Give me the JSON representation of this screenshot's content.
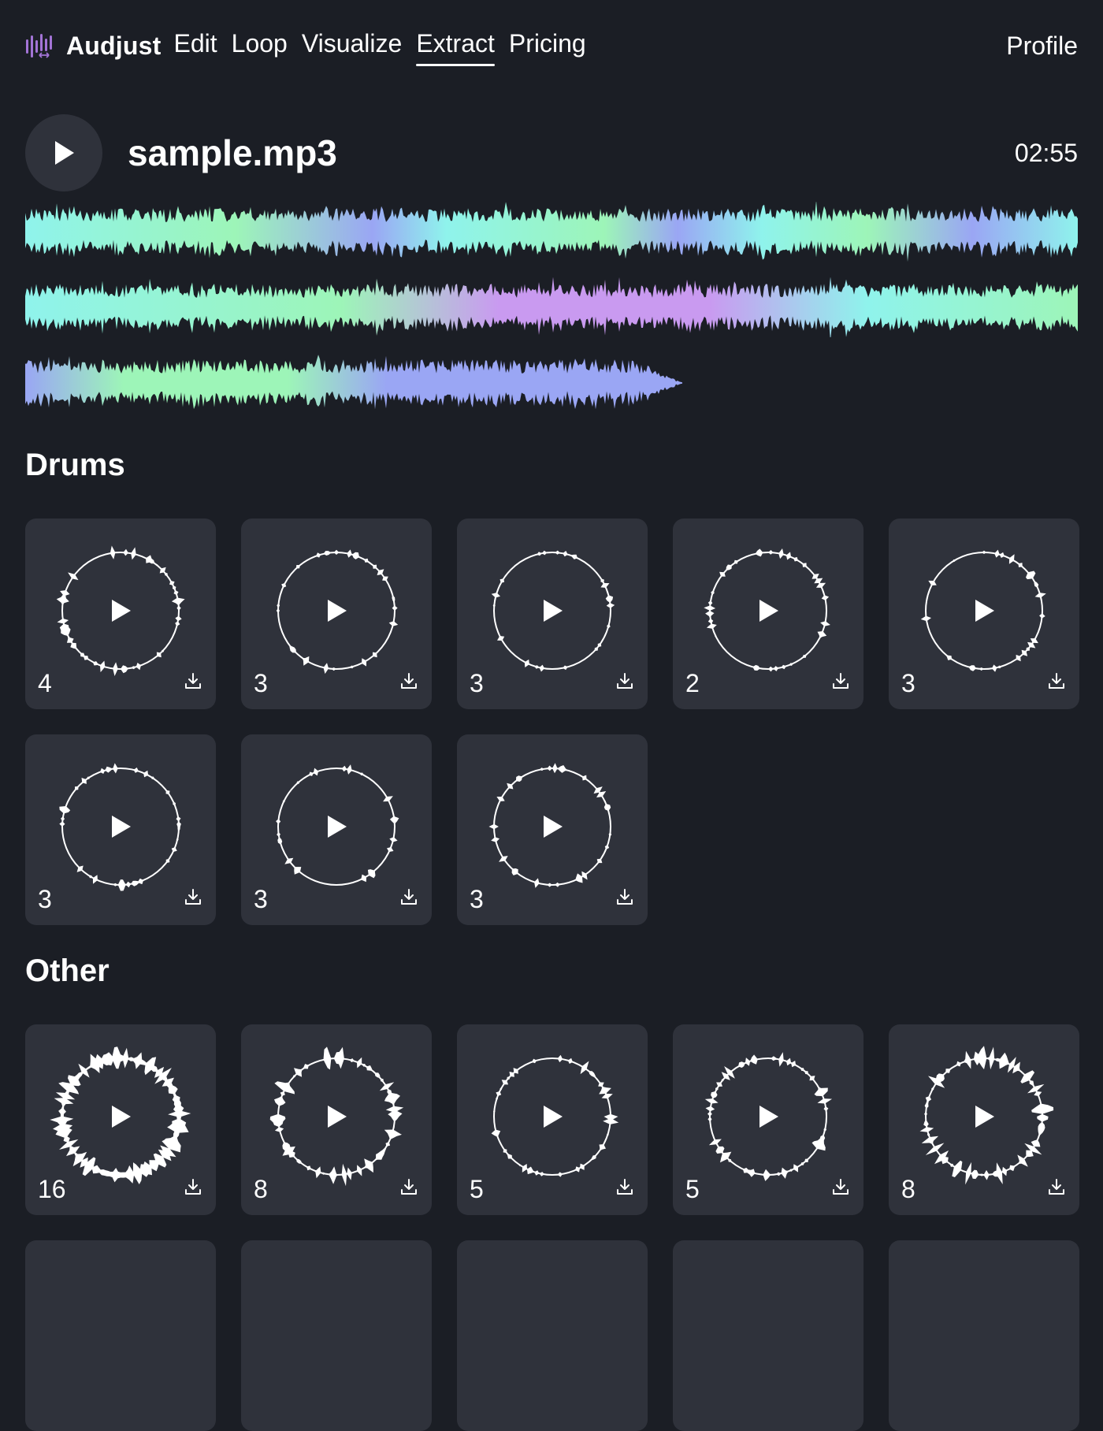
{
  "brand": {
    "name": "Audjust",
    "icon": "waveform-logo-icon"
  },
  "nav": {
    "items": [
      {
        "label": "Edit",
        "active": false
      },
      {
        "label": "Loop",
        "active": false
      },
      {
        "label": "Visualize",
        "active": false
      },
      {
        "label": "Extract",
        "active": true
      },
      {
        "label": "Pricing",
        "active": false
      }
    ],
    "profile": "Profile"
  },
  "track": {
    "filename": "sample.mp3",
    "duration": "02:55",
    "play_icon": "play-icon"
  },
  "sections": [
    {
      "title": "Drums",
      "tiles": [
        {
          "count": "4"
        },
        {
          "count": "3"
        },
        {
          "count": "3"
        },
        {
          "count": "2"
        },
        {
          "count": "3"
        },
        {
          "count": "3"
        },
        {
          "count": "3"
        },
        {
          "count": "3"
        }
      ]
    },
    {
      "title": "Other",
      "tiles": [
        {
          "count": "16"
        },
        {
          "count": "8"
        },
        {
          "count": "5"
        },
        {
          "count": "5"
        },
        {
          "count": "8"
        }
      ]
    }
  ],
  "colors": {
    "background": "#1b1e25",
    "tile": "#2f323b",
    "wave_cyan": "#8ff3ec",
    "wave_green": "#9df5b8",
    "wave_blue": "#9aa6f4",
    "wave_purple": "#c99af0",
    "logo_purple": "#a374d6"
  }
}
